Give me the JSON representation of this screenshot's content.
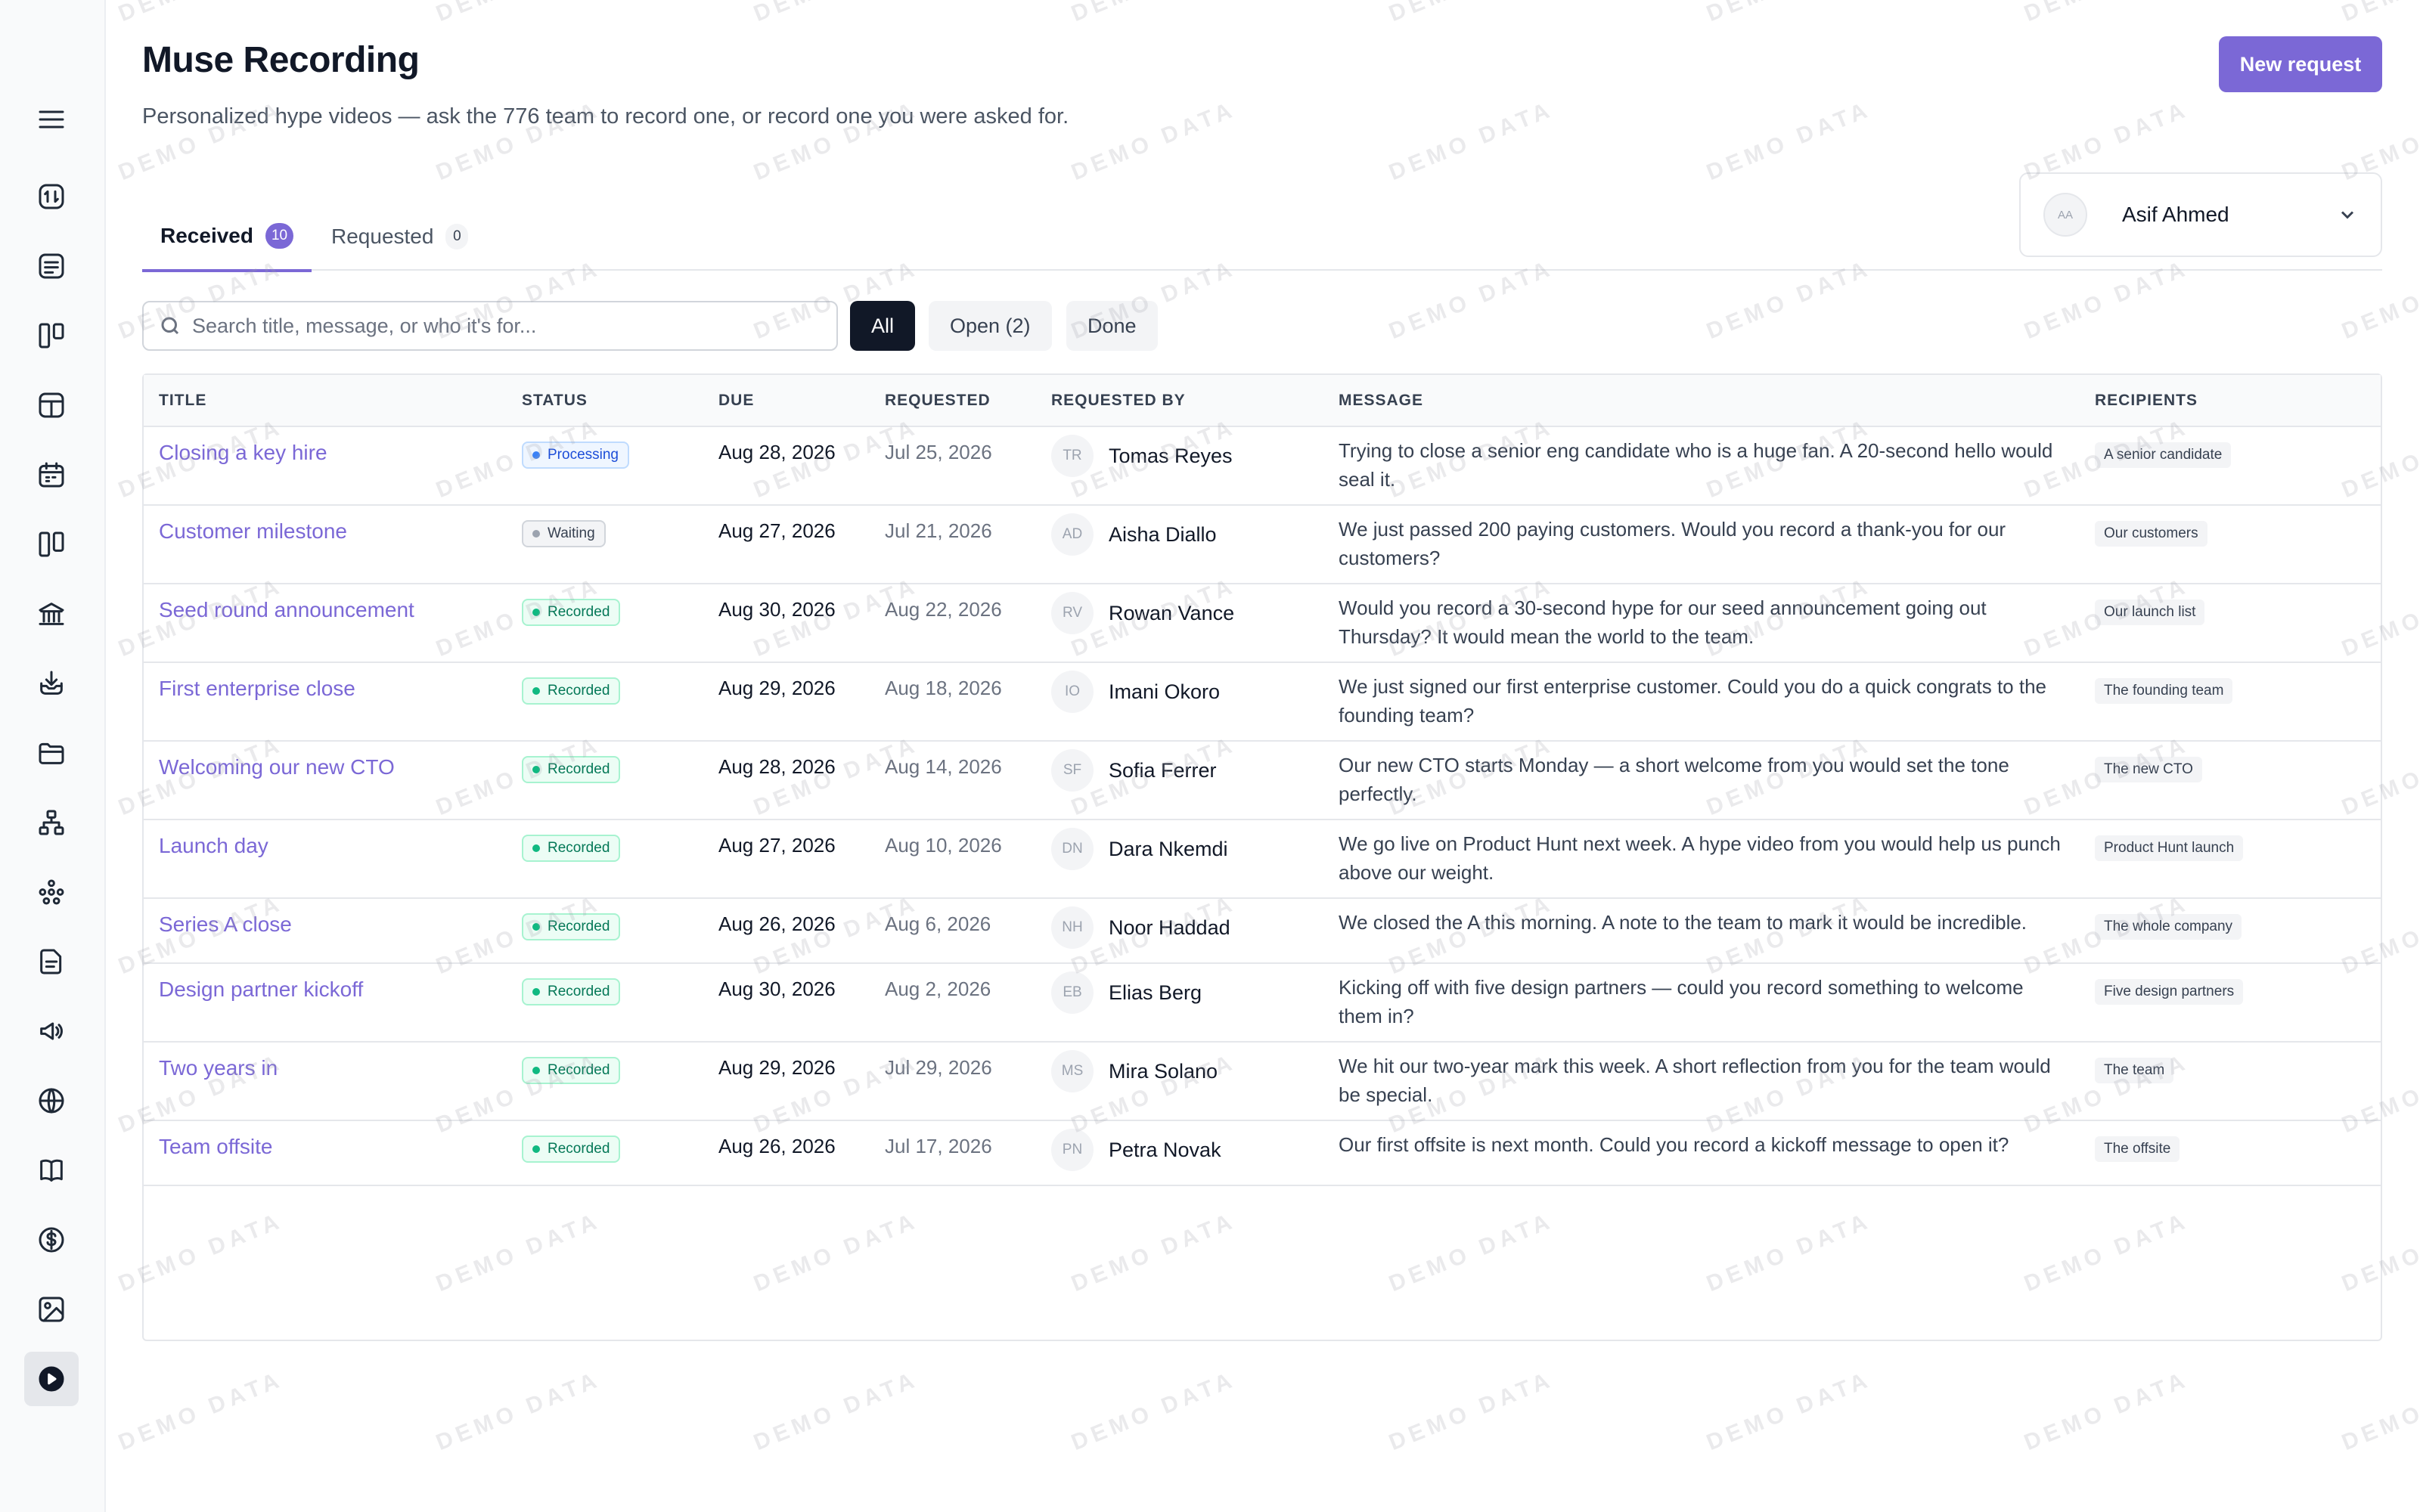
{
  "page": {
    "title": "Muse Recording",
    "subtitle": "Personalized hype videos — ask the 776 team to record one, or record one you were asked for.",
    "new_request_label": "New request"
  },
  "tabs": [
    {
      "label": "Received",
      "count": "10"
    },
    {
      "label": "Requested",
      "count": "0"
    }
  ],
  "user": {
    "initials": "AA",
    "name": "Asif Ahmed"
  },
  "search": {
    "placeholder": "Search title, message, or who it's for..."
  },
  "filters": [
    {
      "label": "All"
    },
    {
      "label": "Open (2)"
    },
    {
      "label": "Done"
    }
  ],
  "table": {
    "headers": [
      "TITLE",
      "STATUS",
      "DUE",
      "REQUESTED",
      "REQUESTED BY",
      "MESSAGE",
      "RECIPIENTS"
    ],
    "rows": [
      {
        "title": "Closing a key hire",
        "status": "Processing",
        "due": "Aug 28, 2026",
        "requested": "Jul 25, 2026",
        "initials": "TR",
        "by": "Tomas Reyes",
        "message": "Trying to close a senior eng candidate who is a huge fan. A 20-second hello would seal it.",
        "recipients": "A senior candidate"
      },
      {
        "title": "Customer milestone",
        "status": "Waiting",
        "due": "Aug 27, 2026",
        "requested": "Jul 21, 2026",
        "initials": "AD",
        "by": "Aisha Diallo",
        "message": "We just passed 200 paying customers. Would you record a thank-you for our customers?",
        "recipients": "Our customers"
      },
      {
        "title": "Seed round announcement",
        "status": "Recorded",
        "due": "Aug 30, 2026",
        "requested": "Aug 22, 2026",
        "initials": "RV",
        "by": "Rowan Vance",
        "message": "Would you record a 30-second hype for our seed announcement going out Thursday? It would mean the world to the team.",
        "recipients": "Our launch list"
      },
      {
        "title": "First enterprise close",
        "status": "Recorded",
        "due": "Aug 29, 2026",
        "requested": "Aug 18, 2026",
        "initials": "IO",
        "by": "Imani Okoro",
        "message": "We just signed our first enterprise customer. Could you do a quick congrats to the founding team?",
        "recipients": "The founding team"
      },
      {
        "title": "Welcoming our new CTO",
        "status": "Recorded",
        "due": "Aug 28, 2026",
        "requested": "Aug 14, 2026",
        "initials": "SF",
        "by": "Sofia Ferrer",
        "message": "Our new CTO starts Monday — a short welcome from you would set the tone perfectly.",
        "recipients": "The new CTO"
      },
      {
        "title": "Launch day",
        "status": "Recorded",
        "due": "Aug 27, 2026",
        "requested": "Aug 10, 2026",
        "initials": "DN",
        "by": "Dara Nkemdi",
        "message": "We go live on Product Hunt next week. A hype video from you would help us punch above our weight.",
        "recipients": "Product Hunt launch"
      },
      {
        "title": "Series A close",
        "status": "Recorded",
        "due": "Aug 26, 2026",
        "requested": "Aug 6, 2026",
        "initials": "NH",
        "by": "Noor Haddad",
        "message": "We closed the A this morning. A note to the team to mark it would be incredible.",
        "recipients": "The whole company"
      },
      {
        "title": "Design partner kickoff",
        "status": "Recorded",
        "due": "Aug 30, 2026",
        "requested": "Aug 2, 2026",
        "initials": "EB",
        "by": "Elias Berg",
        "message": "Kicking off with five design partners — could you record something to welcome them in?",
        "recipients": "Five design partners"
      },
      {
        "title": "Two years in",
        "status": "Recorded",
        "due": "Aug 29, 2026",
        "requested": "Jul 29, 2026",
        "initials": "MS",
        "by": "Mira Solano",
        "message": "We hit our two-year mark this week. A short reflection from you for the team would be special.",
        "recipients": "The team"
      },
      {
        "title": "Team offsite",
        "status": "Recorded",
        "due": "Aug 26, 2026",
        "requested": "Jul 17, 2026",
        "initials": "PN",
        "by": "Petra Novak",
        "message": "Our first offsite is next month. Could you record a kickoff message to open it?",
        "recipients": "The offsite"
      }
    ]
  },
  "watermark": "DEMO DATA",
  "colors": {
    "accent": "#7b68d6",
    "recorded": "#10b981",
    "processing": "#3b82f6",
    "waiting": "#9ca3af"
  },
  "sidebar_icons": [
    "menu-icon",
    "activity-icon",
    "notes-icon",
    "board-icon",
    "layout-icon",
    "calendar-icon",
    "columns-icon",
    "bank-icon",
    "inbox-icon",
    "folder-icon",
    "org-chart-icon",
    "network-icon",
    "document-icon",
    "megaphone-icon",
    "globe-icon",
    "book-icon",
    "dollar-icon",
    "image-icon",
    "play-icon"
  ]
}
